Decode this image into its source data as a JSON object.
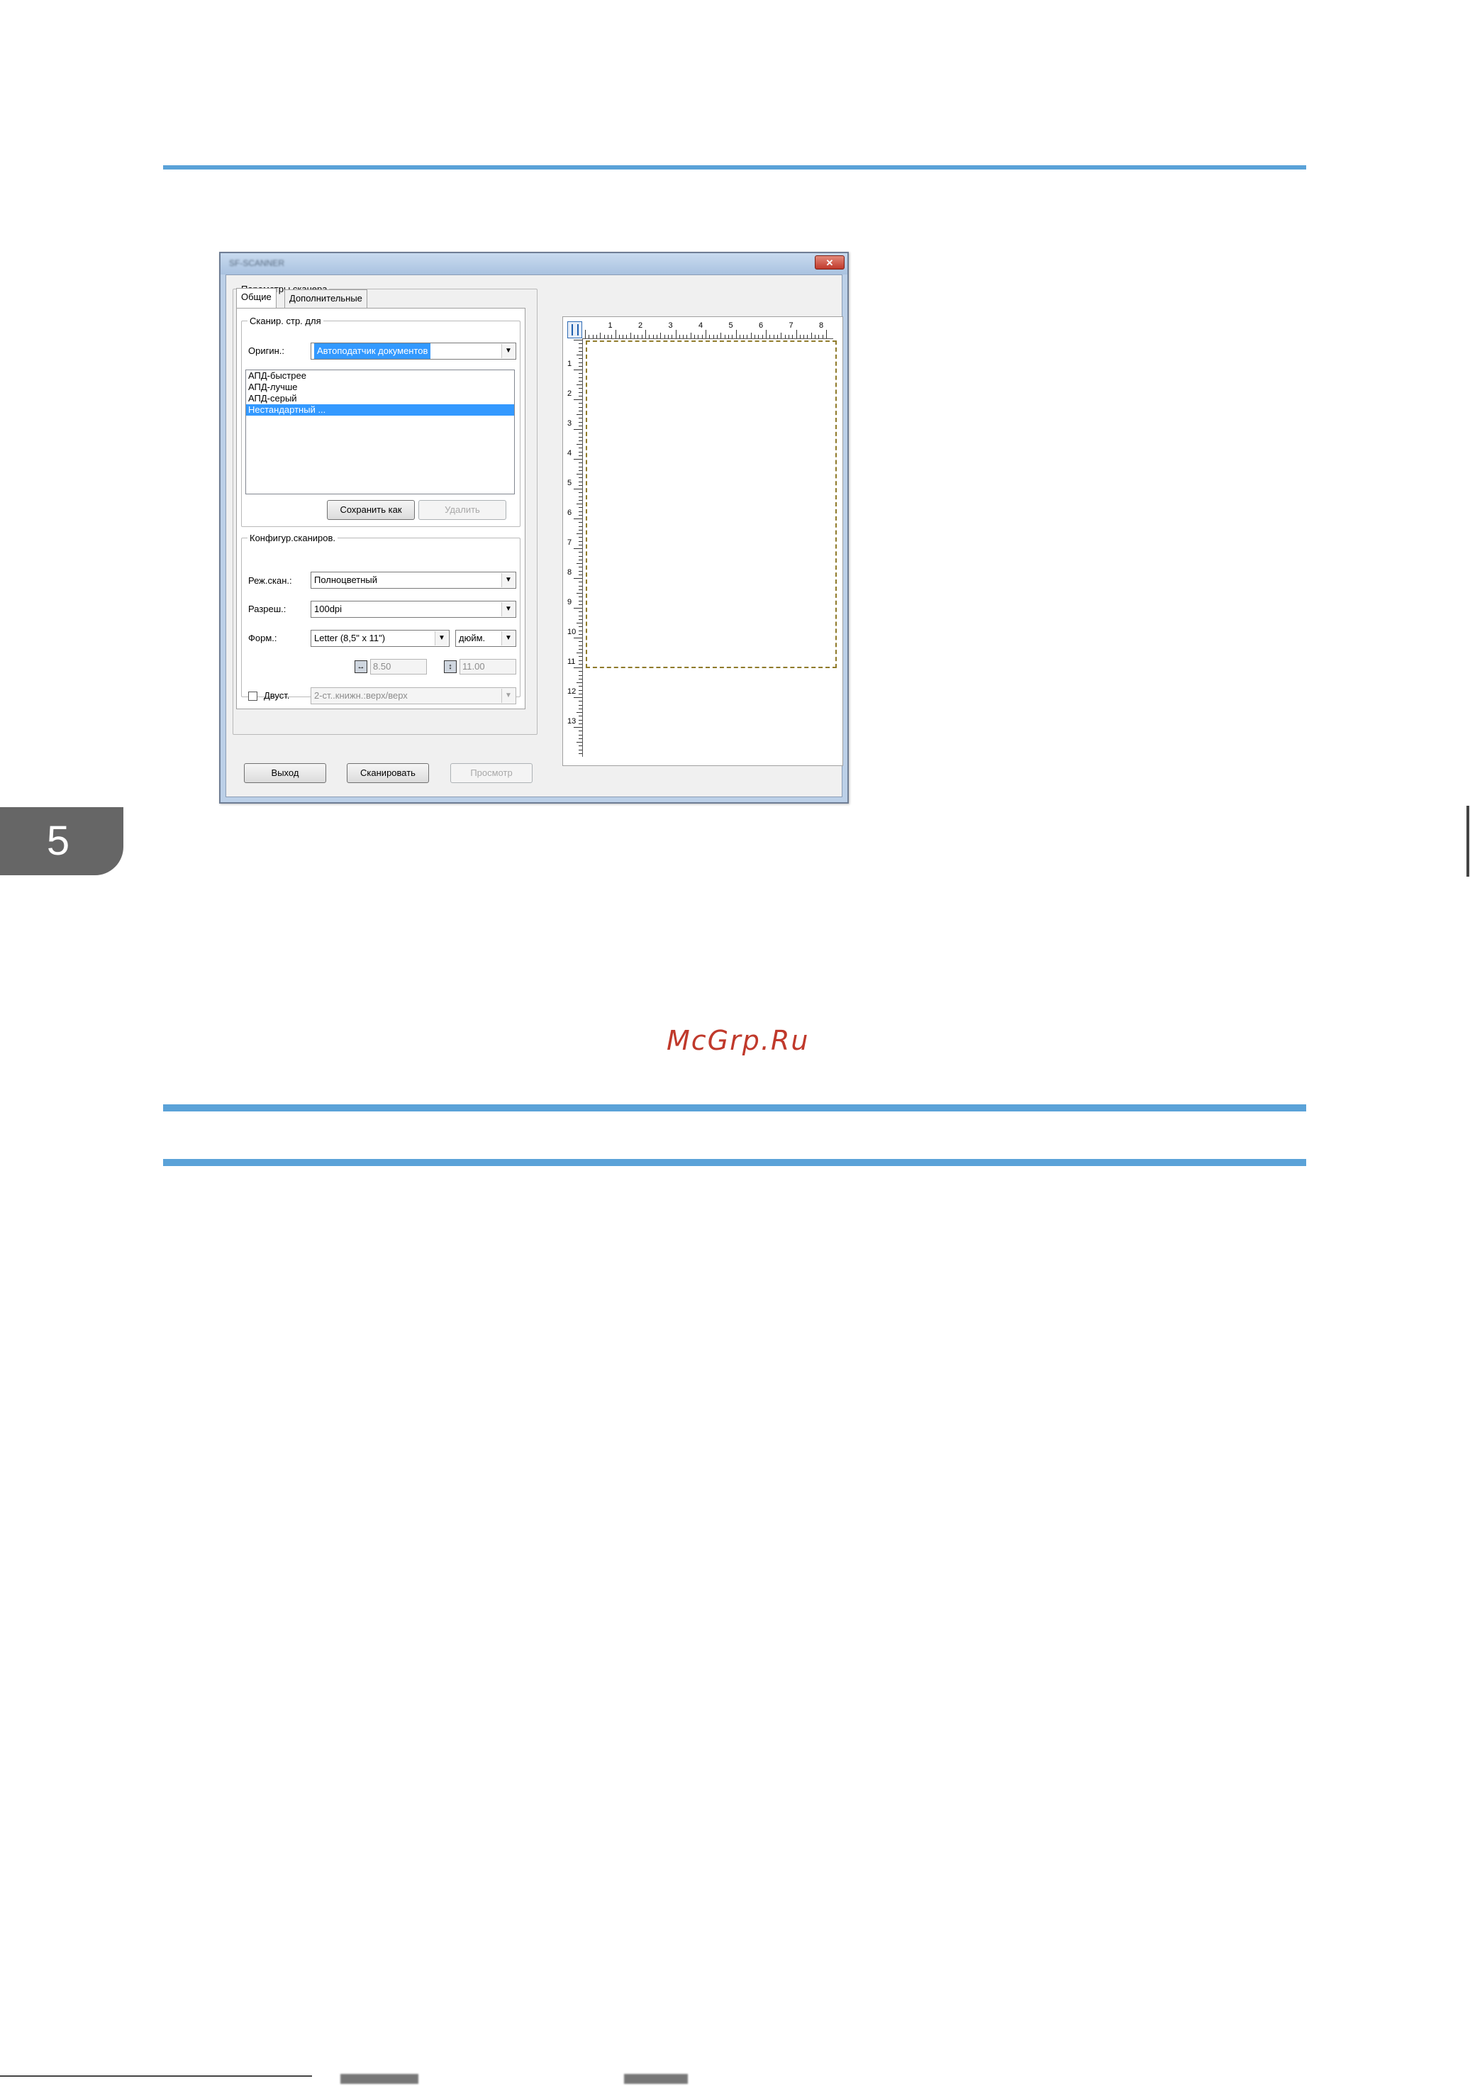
{
  "page": {
    "chapter_number": "5",
    "watermark": "McGrp.Ru"
  },
  "dialog": {
    "title": "SF-SCANNER",
    "close_glyph": "✕",
    "scanner_params_legend": "Параметры сканера",
    "tabs": [
      "Общие",
      "Дополнительные"
    ],
    "scan_pages_legend": "Сканир. стр. для",
    "original_label": "Оригин.:",
    "original_value": "Автоподатчик документов",
    "presets": [
      "АПД-быстрее",
      "АПД-лучше",
      "АПД-серый",
      "Нестандартный ..."
    ],
    "selected_preset_index": 3,
    "save_as_button": "Сохранить как",
    "delete_button": "Удалить",
    "scan_config_legend": "Конфигур.сканиров.",
    "mode_label": "Реж.скан.:",
    "mode_value": "Полноцветный",
    "resolution_label": "Разреш.:",
    "resolution_value": "100dpi",
    "format_label": "Форм.:",
    "format_value": "Letter (8,5\" x 11\")",
    "unit_value": "дюйм.",
    "width_value": "8.50",
    "height_value": "11.00",
    "duplex_label": "Двуст.",
    "duplex_checked": false,
    "duplex_value": "2-ст..книжн.:верх/верх",
    "exit_button": "Выход",
    "scan_button": "Сканировать",
    "preview_button": "Просмотр",
    "ruler_top_labels": [
      "1",
      "2",
      "3",
      "4",
      "5",
      "6",
      "7",
      "8"
    ],
    "ruler_left_labels": [
      "1",
      "2",
      "3",
      "4",
      "5",
      "6",
      "7",
      "8",
      "9",
      "10",
      "11",
      "12",
      "13"
    ],
    "icons": {
      "close": "close-icon",
      "dropdown": "chevron-down-icon",
      "width": "width-arrows-icon",
      "height": "height-arrows-icon",
      "ruler_corner": "ruler-corner-icon"
    },
    "colors": {
      "selection": "#3399ff",
      "scan_area_border": "#8f7a2a",
      "rule_blue": "#5aa2d8",
      "chapter_tab": "#666666"
    }
  }
}
